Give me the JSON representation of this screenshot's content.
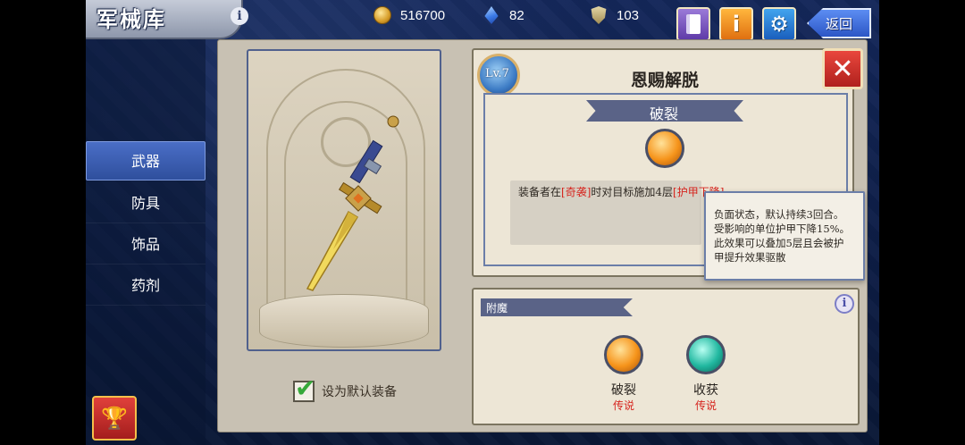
{
  "header": {
    "title": "军械库",
    "info_glyph": "i",
    "back_label": "返回"
  },
  "resources": {
    "coins": "516700",
    "gems": "82",
    "tokens": "103"
  },
  "icons": {
    "coin": "coin-icon",
    "gem": "gem-icon",
    "token": "shield-token-icon",
    "book": "book-icon",
    "info": "info-icon",
    "settings": "gear-icon",
    "back": "back-arrow-icon",
    "trophy": "trophy-icon",
    "close": "close-icon"
  },
  "sidebar": {
    "items": [
      {
        "label": "武器",
        "active": true
      },
      {
        "label": "防具",
        "active": false
      },
      {
        "label": "饰品",
        "active": false
      },
      {
        "label": "药剂",
        "active": false
      }
    ]
  },
  "weapon": {
    "default_label": "设为默认装备",
    "default_checked": true
  },
  "skill": {
    "level": "Lv.7",
    "name": "恩赐解脱",
    "effect_title": "破裂",
    "effect_desc_prefix": "装备者在",
    "effect_desc_tag1": "[奇袭]",
    "effect_desc_mid": "时对目标施加4层",
    "effect_desc_tag2": "[护甲下降]"
  },
  "tooltip": {
    "lines": [
      "负面状态，默认持续3回合。",
      "受影响的单位护甲下降15%。",
      "此效果可以叠加5层且会被护",
      "甲提升效果驱散"
    ]
  },
  "enchant": {
    "title": "附魔",
    "info_glyph": "i",
    "slots": [
      {
        "name": "破裂",
        "rarity": "传说",
        "color": "#f6941b"
      },
      {
        "name": "收获",
        "rarity": "传说",
        "color": "#21b8a0"
      }
    ]
  },
  "colors": {
    "accent_blue": "#2f4f9d",
    "panel": "#ede6d6",
    "highlight_red": "#d6241e"
  }
}
